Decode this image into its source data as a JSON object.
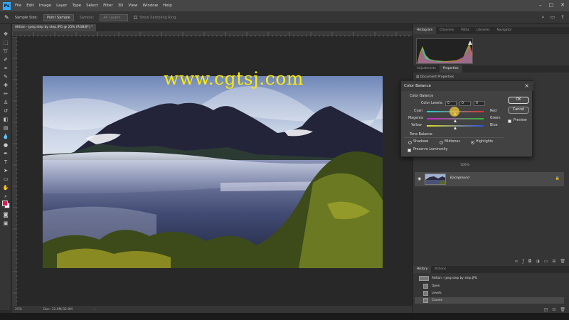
{
  "app": {
    "menu": [
      "File",
      "Edit",
      "Image",
      "Layer",
      "Type",
      "Select",
      "Filter",
      "3D",
      "View",
      "Window",
      "Help"
    ],
    "logo": "Ps"
  },
  "options": {
    "sample_size_label": "Sample Size:",
    "sample_size_value": "Point Sample",
    "sample_label": "Sample:",
    "sample_value": "All Layers",
    "show_ring_label": "Show Sampling Ring"
  },
  "document": {
    "tab_title": "Atitlan - jpeg step by step.JPG @ 25% (RGB/8*) *",
    "status_zoom": "25%",
    "status_doc": "Doc: 32.8M/32.8M"
  },
  "watermark": "www.cgtsj.com",
  "panels": {
    "top_tabs": [
      "Histogram",
      "Channels",
      "Paths",
      "Libraries",
      "Navigator"
    ],
    "mid_tabs": [
      "Adjustments",
      "Properties"
    ],
    "properties_label": "Document Properties",
    "layer_name": "Background",
    "layer_opacity_label": "100%",
    "history_tabs": [
      "History",
      "Actions"
    ],
    "history_items": [
      "Atitlan - jpeg step by step.JPG",
      "Open",
      "Levels",
      "Curves"
    ]
  },
  "dialog": {
    "title": "Color Balance",
    "section_color": "Color Balance",
    "color_levels_label": "Color Levels:",
    "levels": [
      "0",
      "0",
      "0"
    ],
    "sliders": [
      {
        "left": "Cyan",
        "right": "Red",
        "value": 0,
        "color": "#e03030"
      },
      {
        "left": "Magenta",
        "right": "Green",
        "value": 0,
        "color": "#30c030"
      },
      {
        "left": "Yellow",
        "right": "Blue",
        "value": 0,
        "color": "#3050e0"
      }
    ],
    "section_tone": "Tone Balance",
    "tones": [
      "Shadows",
      "Midtones",
      "Highlights"
    ],
    "tone_selected": "Highlights",
    "preserve_label": "Preserve Luminosity",
    "ok_label": "OK",
    "cancel_label": "Cancel",
    "preview_label": "Preview"
  }
}
